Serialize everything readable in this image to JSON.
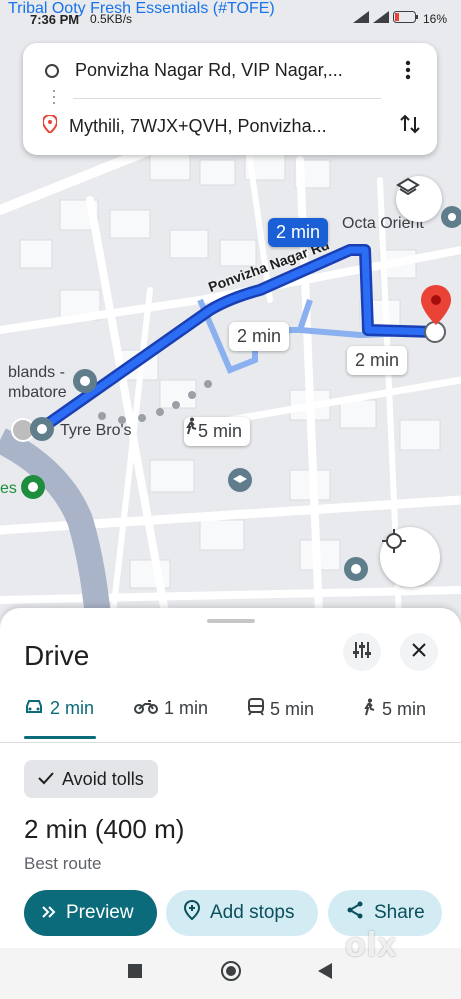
{
  "status_bar": {
    "time": "7:36 PM",
    "network_speed": "0.5KB/s",
    "battery": "16%"
  },
  "map": {
    "top_label": "Tribal Ooty Fresh Essentials (#TOFE)",
    "place_labels": [
      "Octa Orient",
      "blands -",
      "mbatore",
      "Tyre Bro's",
      "es"
    ],
    "road_label": "Ponvizha Nagar Rd",
    "chips": [
      {
        "text": "2 min",
        "selected": true
      },
      {
        "text": "2 min",
        "selected": false
      },
      {
        "text": "2 min",
        "selected": false
      },
      {
        "text": "5 min",
        "selected": false,
        "icon": "walk-icon"
      }
    ],
    "route_color": "#1a5fd6"
  },
  "directions_card": {
    "origin": "Ponvizha Nagar Rd, VIP Nagar,...",
    "destination": "Mythili, 7WJX+QVH, Ponvizha..."
  },
  "sheet": {
    "title": "Drive",
    "modes": [
      {
        "icon": "car-icon",
        "label": "2 min",
        "active": true
      },
      {
        "icon": "motorcycle-icon",
        "label": "1 min",
        "active": false
      },
      {
        "icon": "transit-icon",
        "label": "5 min",
        "active": false
      },
      {
        "icon": "walk-icon",
        "label": "5 min",
        "active": false
      }
    ],
    "avoid_tolls": "Avoid tolls",
    "eta_time": "2 min",
    "eta_distance": "(400 m)",
    "route_note": "Best route",
    "actions": {
      "preview": "Preview",
      "add_stops": "Add stops",
      "share": "Share"
    },
    "accent": "#0b6b7a"
  },
  "watermark": "olx"
}
